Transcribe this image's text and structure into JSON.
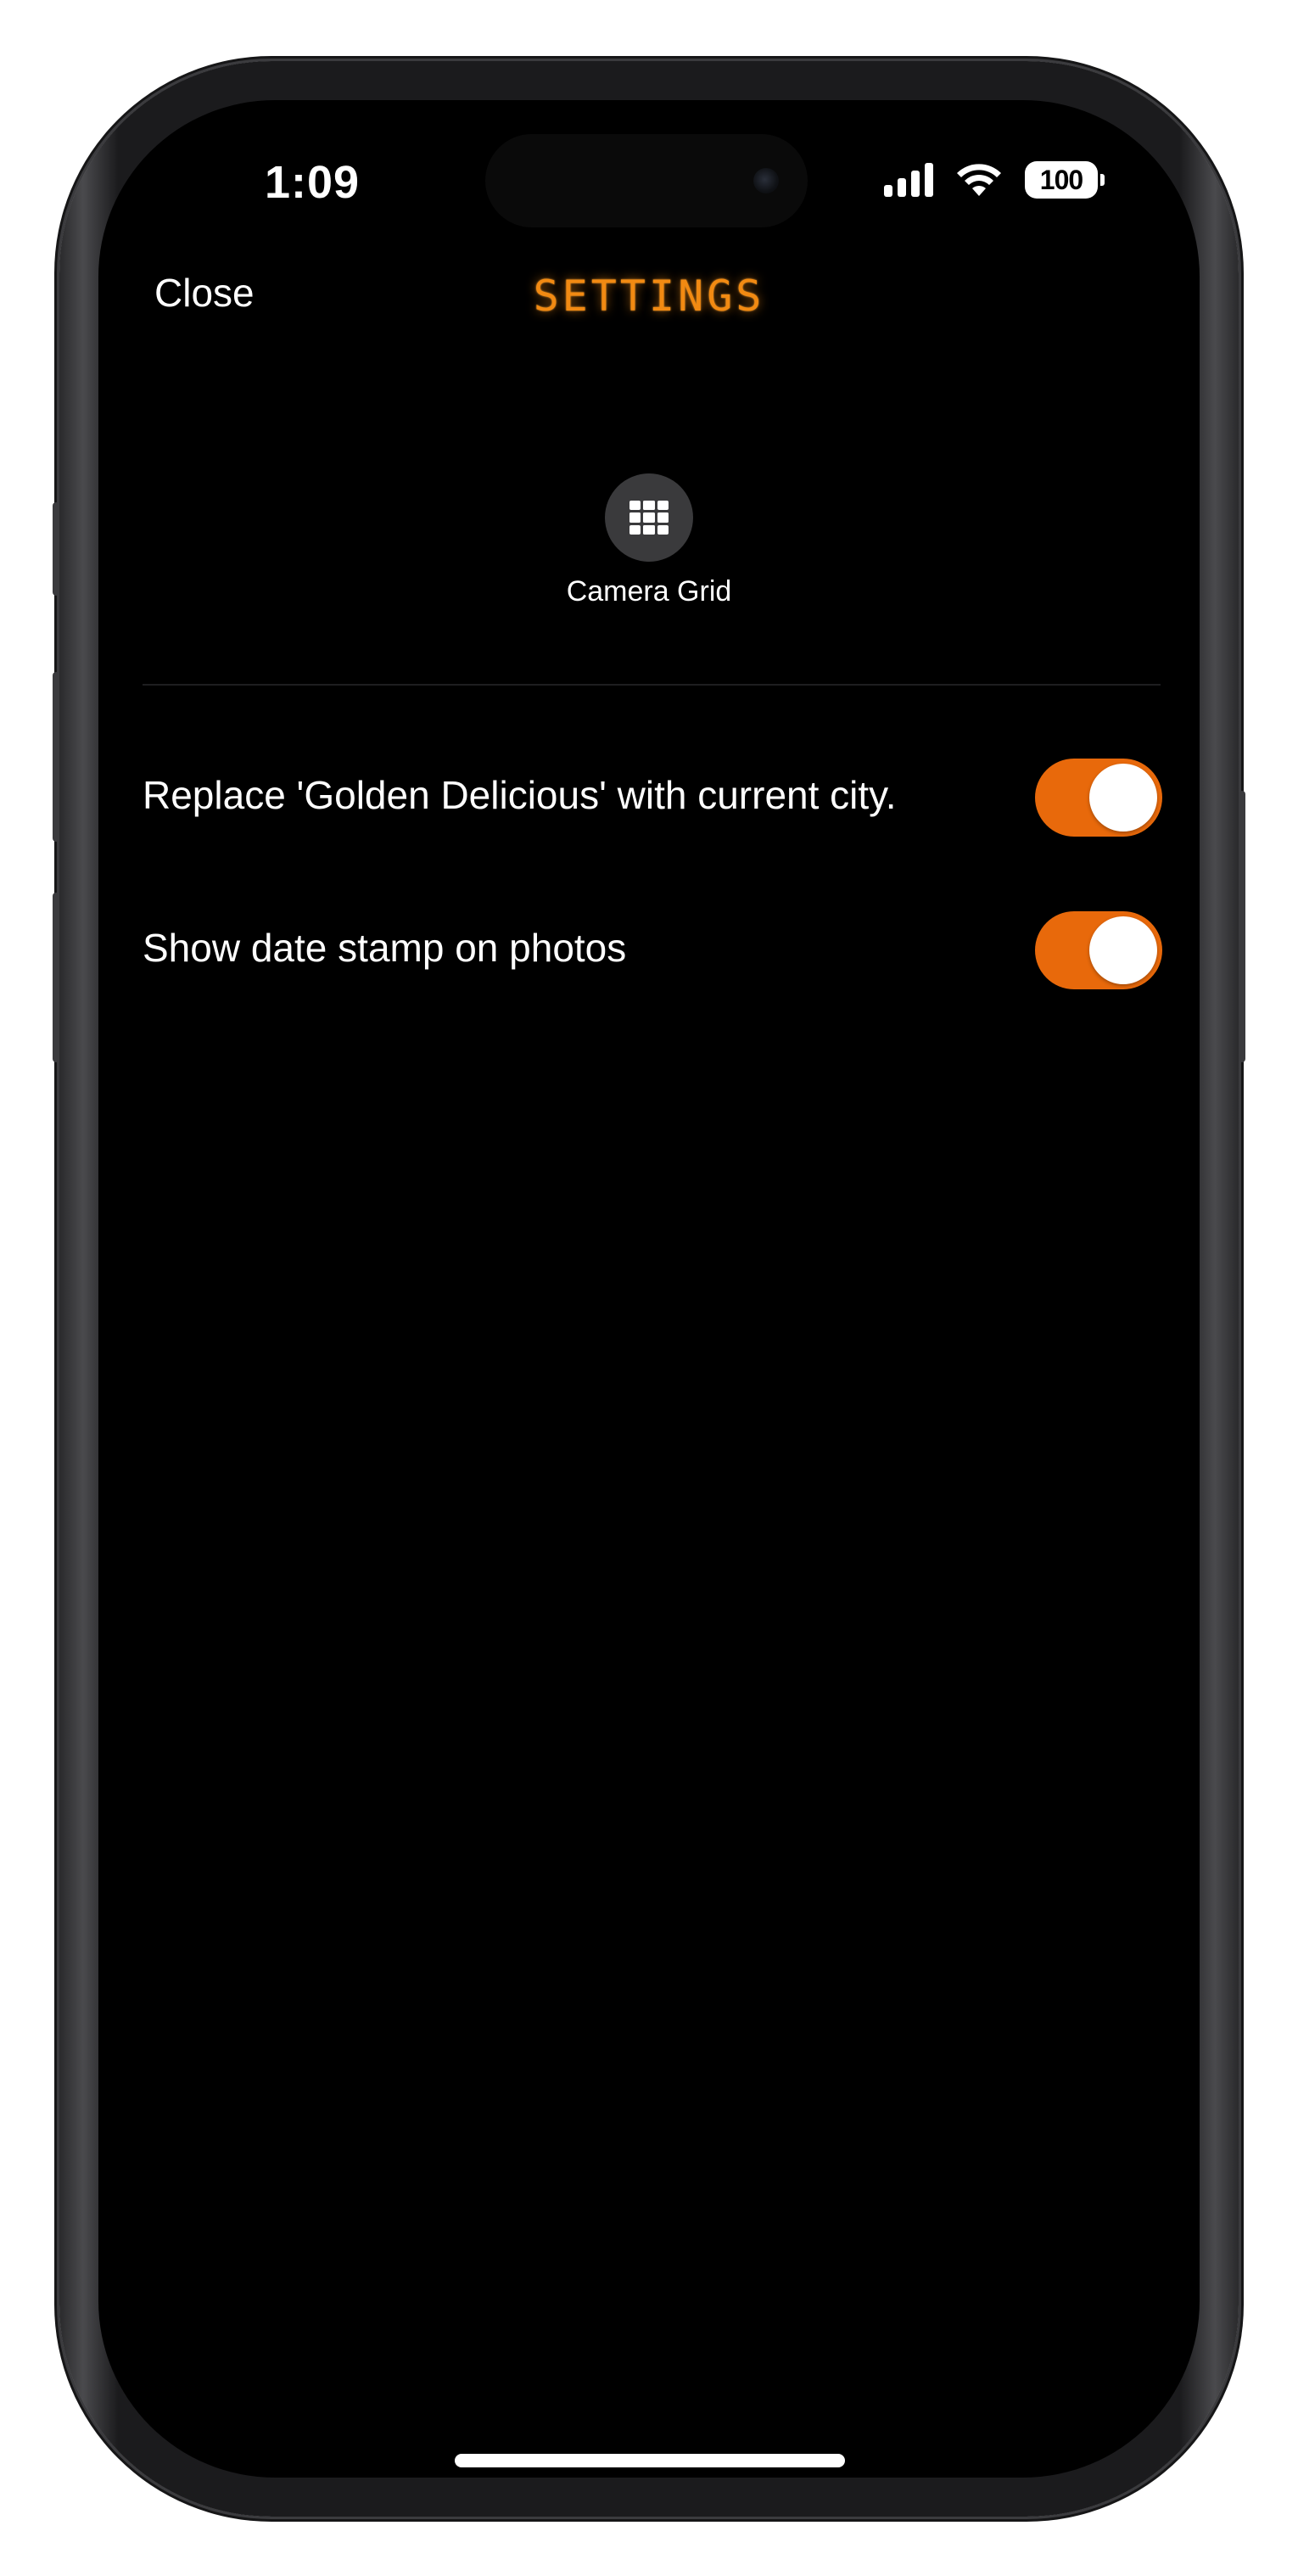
{
  "status_bar": {
    "time": "1:09",
    "battery": "100",
    "icons": [
      "cellular-signal-icon",
      "wifi-icon",
      "battery-icon"
    ]
  },
  "nav": {
    "close_label": "Close",
    "title": "SETTINGS"
  },
  "camera_grid": {
    "label": "Camera Grid",
    "icon": "grid-icon"
  },
  "settings": {
    "rows": [
      {
        "label": "Replace 'Golden Delicious' with current city.",
        "enabled": true
      },
      {
        "label": "Show date stamp on photos",
        "enabled": true
      }
    ]
  },
  "colors": {
    "accent": "#e8690b",
    "title_glow": "#f28a12",
    "background": "#000000"
  }
}
